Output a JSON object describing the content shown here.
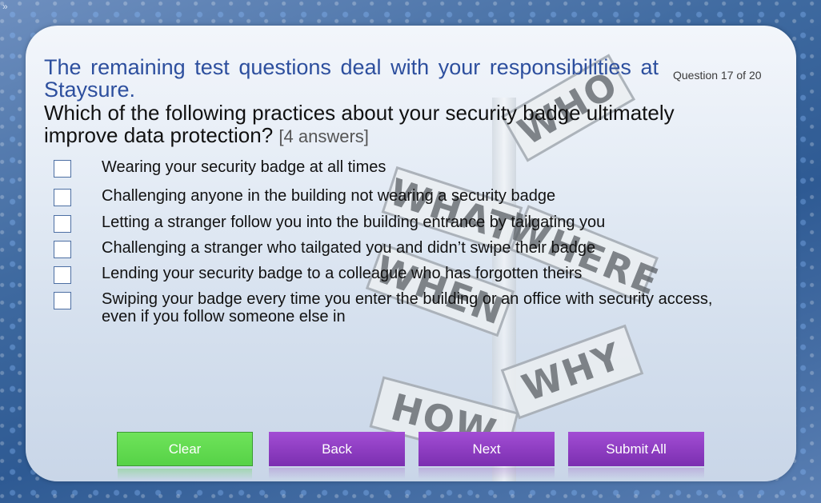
{
  "chrome": {
    "corner_glyph": "»"
  },
  "header": {
    "intro": "The remaining test questions deal with your responsibilities at Staysure.",
    "counter": "Question 17 of 20"
  },
  "question": {
    "text": "Which of the following practices about your security badge ultimately improve data protection?",
    "hint": "[4 answers]"
  },
  "options": [
    {
      "label": "Wearing your security badge at all times",
      "checked": false
    },
    {
      "label": "Challenging anyone in the building not wearing a security badge",
      "checked": false
    },
    {
      "label": "Letting a stranger follow you into the building entrance by tailgating you",
      "checked": false
    },
    {
      "label": "Challenging a stranger who tailgated you and didn’t swipe their badge",
      "checked": false
    },
    {
      "label": "Lending your security badge to a colleague who has forgotten theirs",
      "checked": false
    },
    {
      "label": "Swiping your badge every time you enter the building or an office with security access, even if you follow someone else in",
      "checked": false
    }
  ],
  "signpost": {
    "who": "WHO",
    "what": "WHAT",
    "where": "WHERE",
    "when": "WHEN",
    "why": "WHY",
    "how": "HOW"
  },
  "buttons": {
    "clear": "Clear",
    "back": "Back",
    "next": "Next",
    "submit": "Submit All"
  },
  "colors": {
    "clear": "#5fd94e",
    "nav": "#8a39bf",
    "intro_text": "#2d4f9e"
  }
}
